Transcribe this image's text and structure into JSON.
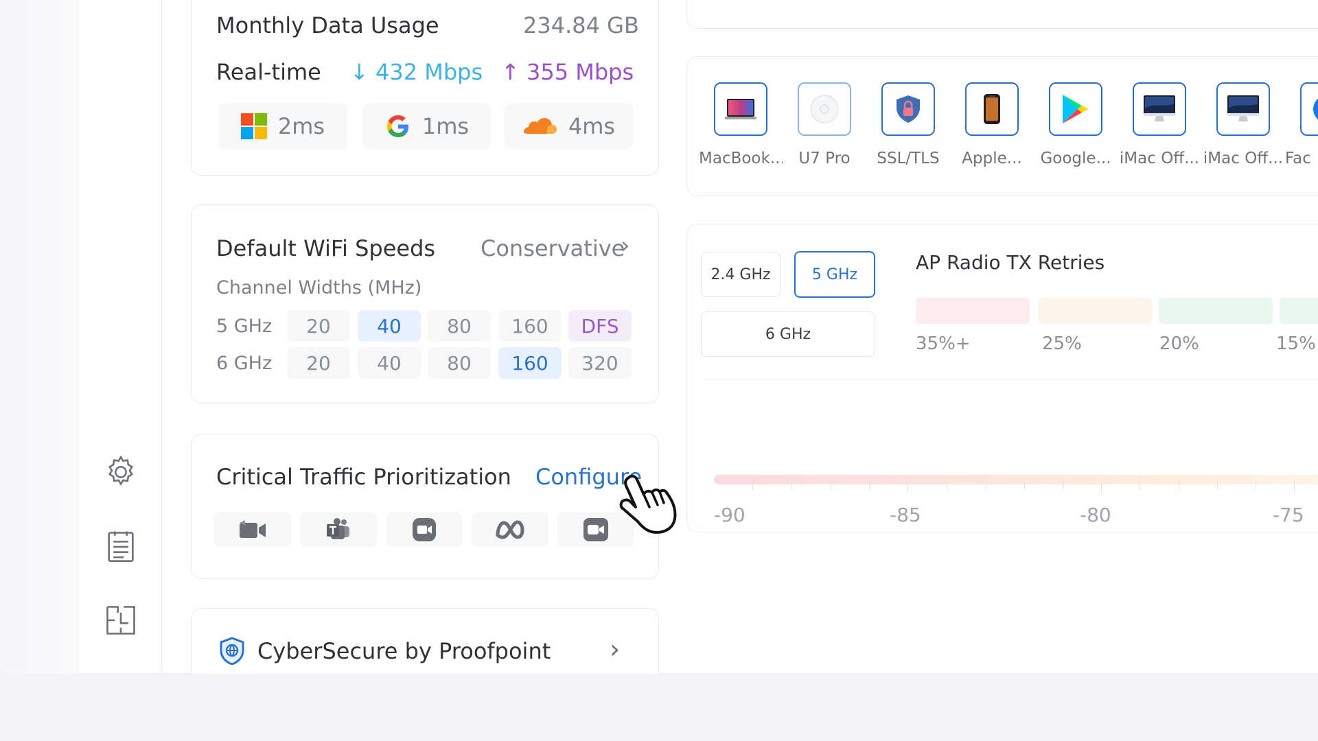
{
  "usage": {
    "monthly_label": "Monthly Data Usage",
    "monthly_value": "234.84 GB",
    "realtime_label": "Real-time",
    "down_value": "432 Mbps",
    "up_value": "355 Mbps",
    "down_color": "#3db3e3",
    "up_color": "#9b50c8",
    "pings": [
      {
        "icon": "microsoft-icon",
        "value": "2ms"
      },
      {
        "icon": "google-icon",
        "value": "1ms"
      },
      {
        "icon": "cloudflare-icon",
        "value": "4ms"
      }
    ]
  },
  "wifi": {
    "title": "Default WiFi Speeds",
    "profile": "Conservative",
    "subtitle": "Channel Widths (MHz)",
    "rows": [
      {
        "band": "5 GHz",
        "options": [
          "20",
          "40",
          "80",
          "160",
          "DFS"
        ],
        "selected": "40"
      },
      {
        "band": "6 GHz",
        "options": [
          "20",
          "40",
          "80",
          "160",
          "320"
        ],
        "selected": "160"
      }
    ]
  },
  "priority": {
    "title": "Critical Traffic Prioritization",
    "configure_label": "Configure",
    "apps": [
      "video-camera-icon",
      "teams-icon",
      "zoom-icon",
      "meta-icon",
      "facetime-icon"
    ]
  },
  "cyber": {
    "title": "CyberSecure by Proofpoint"
  },
  "clients": [
    {
      "label": "MacBook...",
      "icon": "macbook-icon"
    },
    {
      "label": "U7 Pro",
      "icon": "access-point-icon"
    },
    {
      "label": "SSL/TLS",
      "icon": "shield-lock-icon"
    },
    {
      "label": "Apple...",
      "icon": "iphone-icon"
    },
    {
      "label": "Google...",
      "icon": "google-play-icon"
    },
    {
      "label": "iMac Off...",
      "icon": "imac-icon"
    },
    {
      "label": "iMac Off...",
      "icon": "imac-icon"
    },
    {
      "label": "Fac",
      "icon": "facebook-icon"
    }
  ],
  "radio": {
    "bands": [
      "2.4 GHz",
      "5 GHz",
      "6 GHz"
    ],
    "selected_band": "5 GHz",
    "title": "AP Radio TX Retries",
    "legend": [
      "35%+",
      "25%",
      "20%",
      "15%"
    ],
    "rssi_scale": [
      "-90",
      "-85",
      "-80",
      "-75"
    ],
    "accent": "#2a72c8"
  }
}
